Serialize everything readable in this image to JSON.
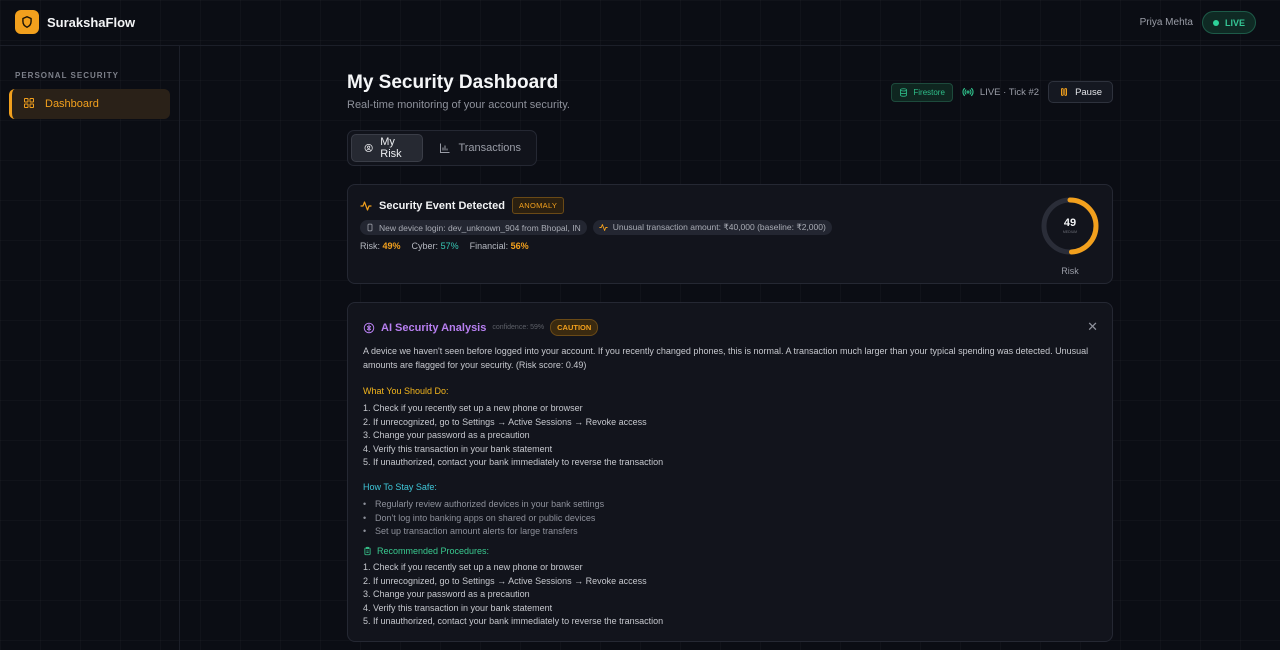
{
  "app": {
    "name": "SurakshaFlow"
  },
  "header": {
    "user_name": "Priya Mehta",
    "live_label": "LIVE"
  },
  "sidebar": {
    "section_label": "PERSONAL SECURITY",
    "items": [
      {
        "label": "Dashboard",
        "icon": "grid-icon",
        "active": true
      }
    ]
  },
  "page": {
    "title": "My Security Dashboard",
    "subtitle": "Real-time monitoring of your account security."
  },
  "controls": {
    "firestore_label": "Firestore",
    "live_tick_label": "LIVE · Tick #2",
    "pause_label": "Pause"
  },
  "tabs": [
    {
      "label": "My Risk",
      "icon": "user-circle-icon",
      "active": true
    },
    {
      "label": "Transactions",
      "icon": "bar-chart-icon",
      "active": false
    }
  ],
  "event": {
    "title": "Security Event Detected",
    "badge": "ANOMALY",
    "chips": [
      {
        "icon": "phone-icon",
        "text": "New device login: dev_unknown_904 from Bhopal, IN"
      },
      {
        "icon": "activity-icon",
        "text": "Unusual transaction amount: ₹40,000 (baseline: ₹2,000)"
      }
    ],
    "scores": {
      "risk_label": "Risk:",
      "risk_value": "49%",
      "cyber_label": "Cyber:",
      "cyber_value": "57%",
      "financial_label": "Financial:",
      "financial_value": "56%"
    },
    "gauge": {
      "value": 49,
      "max": 100,
      "sublabel": "MEDIUM",
      "label": "Risk",
      "color": "#f2a01d"
    }
  },
  "ai": {
    "title": "AI Security Analysis",
    "confidence": "confidence: 59%",
    "badge": "CAUTION",
    "summary": "A device we haven't seen before logged into your account. If you recently changed phones, this is normal. A transaction much larger than your typical spending was detected. Unusual amounts are flagged for your security. (Risk score: 0.49)",
    "do_title": "What You Should Do:",
    "do_items": [
      "1. Check if you recently set up a new phone or browser",
      "2. If unrecognized, go to Settings → Active Sessions → Revoke access",
      "3. Change your password as a precaution",
      "4. Verify this transaction in your bank statement",
      "5. If unauthorized, contact your bank immediately to reverse the transaction"
    ],
    "safe_title": "How To Stay Safe:",
    "safe_items": [
      "Regularly review authorized devices in your bank settings",
      "Don't log into banking apps on shared or public devices",
      "Set up transaction amount alerts for large transfers"
    ],
    "proc_title": "Recommended Procedures:",
    "proc_items": [
      "1. Check if you recently set up a new phone or browser",
      "2. If unrecognized, go to Settings → Active Sessions → Revoke access",
      "3. Change your password as a precaution",
      "4. Verify this transaction in your bank statement",
      "5. If unauthorized, contact your bank immediately to reverse the transaction"
    ]
  },
  "colors": {
    "accent": "#f2a01d",
    "live": "#2ed39a",
    "ai": "#b77ff0",
    "cyan": "#3fc6d8",
    "green": "#39c98f"
  }
}
